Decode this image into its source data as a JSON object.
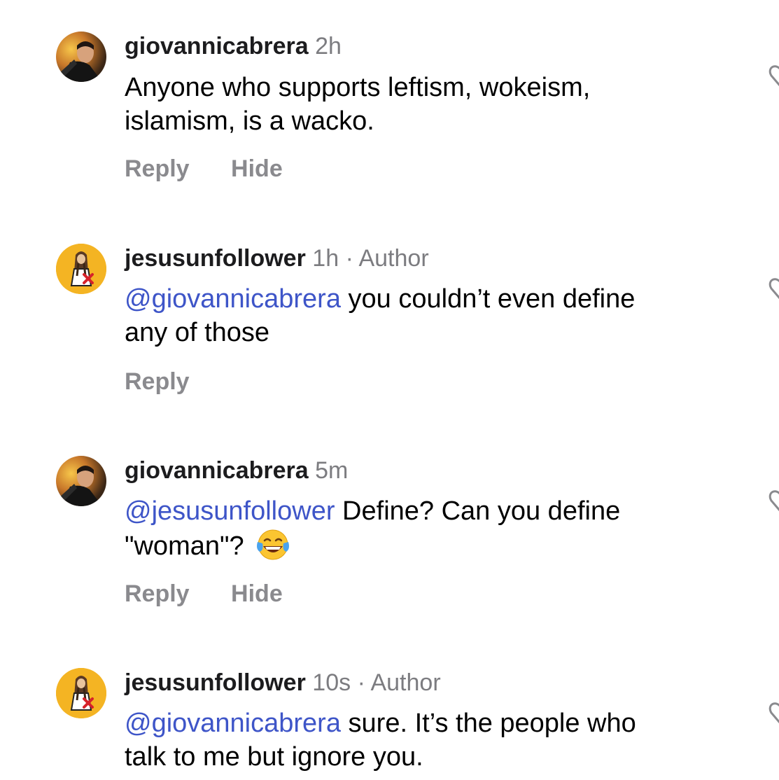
{
  "comments": [
    {
      "username": "giovannicabrera",
      "time": "2h",
      "author_badge": "",
      "mention": "",
      "text_line1": "Anyone who supports leftism, wokeism,",
      "text_line2": "islamism, is a  wacko.",
      "reply_label": "Reply",
      "hide_label": "Hide",
      "avatar": "profile-photo-avatar"
    },
    {
      "username": "jesusunfollower",
      "time": "1h",
      "separator": "·",
      "author_badge": "Author",
      "mention": "@giovannicabrera",
      "text_line1_rest": " you couldn’t even define",
      "text_line2": "any of those",
      "reply_label": "Reply",
      "avatar": "unfollow-cartoon-avatar"
    },
    {
      "username": "giovannicabrera",
      "time": "5m",
      "author_badge": "",
      "mention": "@jesusunfollower",
      "text_line1_rest": " Define? Can you define",
      "text_line2": "\"woman\"?",
      "emoji": "tears-of-joy-emoji",
      "reply_label": "Reply",
      "hide_label": "Hide",
      "avatar": "profile-photo-avatar"
    },
    {
      "username": "jesusunfollower",
      "time": "10s",
      "separator": "·",
      "author_badge": "Author",
      "mention": "@giovannicabrera",
      "text_line1_rest": " sure. It’s the people who",
      "text_line2": "talk to me but ignore you.",
      "avatar": "unfollow-cartoon-avatar"
    }
  ],
  "colors": {
    "mention": "#3e55c8",
    "meta_gray": "#7c7c80",
    "action_gray": "#8a8a8e",
    "avatar_yellow": "#f4b423"
  },
  "icons": {
    "like": "heart-outline-icon"
  }
}
